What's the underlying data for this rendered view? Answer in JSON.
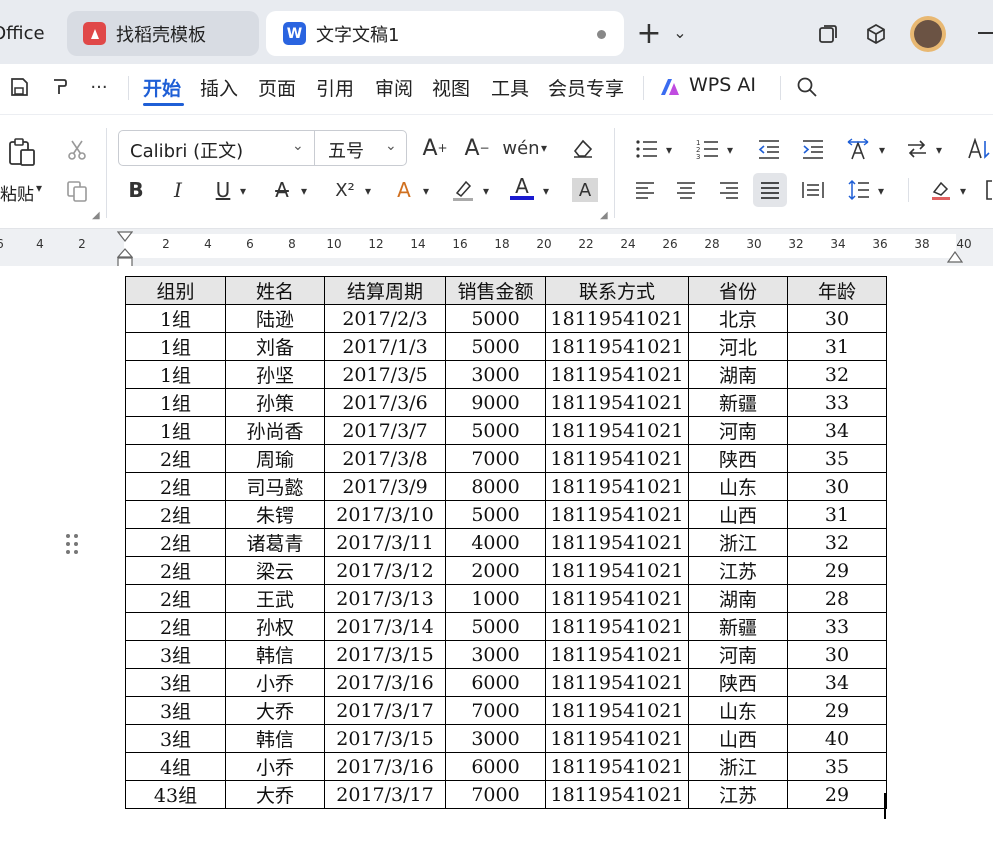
{
  "tabs": {
    "office_label": "Office",
    "template_label": "找稻壳模板",
    "doc_label": "文字文稿1",
    "doc_icon_letter": "W",
    "add_symbol": "+",
    "dropdown_symbol": "⌄"
  },
  "ribbon": {
    "more_symbol": "···",
    "tabs": [
      "开始",
      "插入",
      "页面",
      "引用",
      "审阅",
      "视图",
      "工具",
      "会员专享"
    ],
    "wps_ai_label": "WPS AI"
  },
  "toolbar": {
    "paste_label": "粘贴",
    "font_name": "Calibri (正文)",
    "font_size": "五号",
    "bold": "B",
    "italic": "I",
    "underline": "U",
    "strike": "A",
    "superscript": "X²",
    "font_color": "A",
    "highlight": "A"
  },
  "ruler": {
    "left_numbers": [
      "6",
      "4",
      "2"
    ],
    "right_numbers": [
      "2",
      "4",
      "6",
      "8",
      "10",
      "12",
      "14",
      "16",
      "18",
      "20",
      "22",
      "24",
      "26",
      "28",
      "30",
      "32",
      "34",
      "36",
      "38",
      "40"
    ]
  },
  "table": {
    "headers": [
      "组别",
      "姓名",
      "结算周期",
      "销售金额",
      "联系方式",
      "省份",
      "年龄"
    ],
    "rows": [
      [
        "1组",
        "陆逊",
        "2017/2/3",
        "5000",
        "18119541021",
        "北京",
        "30"
      ],
      [
        "1组",
        "刘备",
        "2017/1/3",
        "5000",
        "18119541021",
        "河北",
        "31"
      ],
      [
        "1组",
        "孙坚",
        "2017/3/5",
        "3000",
        "18119541021",
        "湖南",
        "32"
      ],
      [
        "1组",
        "孙策",
        "2017/3/6",
        "9000",
        "18119541021",
        "新疆",
        "33"
      ],
      [
        "1组",
        "孙尚香",
        "2017/3/7",
        "5000",
        "18119541021",
        "河南",
        "34"
      ],
      [
        "2组",
        "周瑜",
        "2017/3/8",
        "7000",
        "18119541021",
        "陕西",
        "35"
      ],
      [
        "2组",
        "司马懿",
        "2017/3/9",
        "8000",
        "18119541021",
        "山东",
        "30"
      ],
      [
        "2组",
        "朱锷",
        "2017/3/10",
        "5000",
        "18119541021",
        "山西",
        "31"
      ],
      [
        "2组",
        "诸葛青",
        "2017/3/11",
        "4000",
        "18119541021",
        "浙江",
        "32"
      ],
      [
        "2组",
        "梁云",
        "2017/3/12",
        "2000",
        "18119541021",
        "江苏",
        "29"
      ],
      [
        "2组",
        "王武",
        "2017/3/13",
        "1000",
        "18119541021",
        "湖南",
        "28"
      ],
      [
        "2组",
        "孙权",
        "2017/3/14",
        "5000",
        "18119541021",
        "新疆",
        "33"
      ],
      [
        "3组",
        "韩信",
        "2017/3/15",
        "3000",
        "18119541021",
        "河南",
        "30"
      ],
      [
        "3组",
        "小乔",
        "2017/3/16",
        "6000",
        "18119541021",
        "陕西",
        "34"
      ],
      [
        "3组",
        "大乔",
        "2017/3/17",
        "7000",
        "18119541021",
        "山东",
        "29"
      ],
      [
        "3组",
        "韩信",
        "2017/3/15",
        "3000",
        "18119541021",
        "山西",
        "40"
      ],
      [
        "4组",
        "小乔",
        "2017/3/16",
        "6000",
        "18119541021",
        "浙江",
        "35"
      ],
      [
        "43组",
        "大乔",
        "2017/3/17",
        "7000",
        "18119541021",
        "江苏",
        "29"
      ]
    ]
  },
  "colors": {
    "accent": "#1f5fd6",
    "template_icon": "#e04848",
    "doc_icon": "#2a64e0",
    "tab_bar": "#e8ebf0",
    "header_fill": "#e6e6e6"
  }
}
